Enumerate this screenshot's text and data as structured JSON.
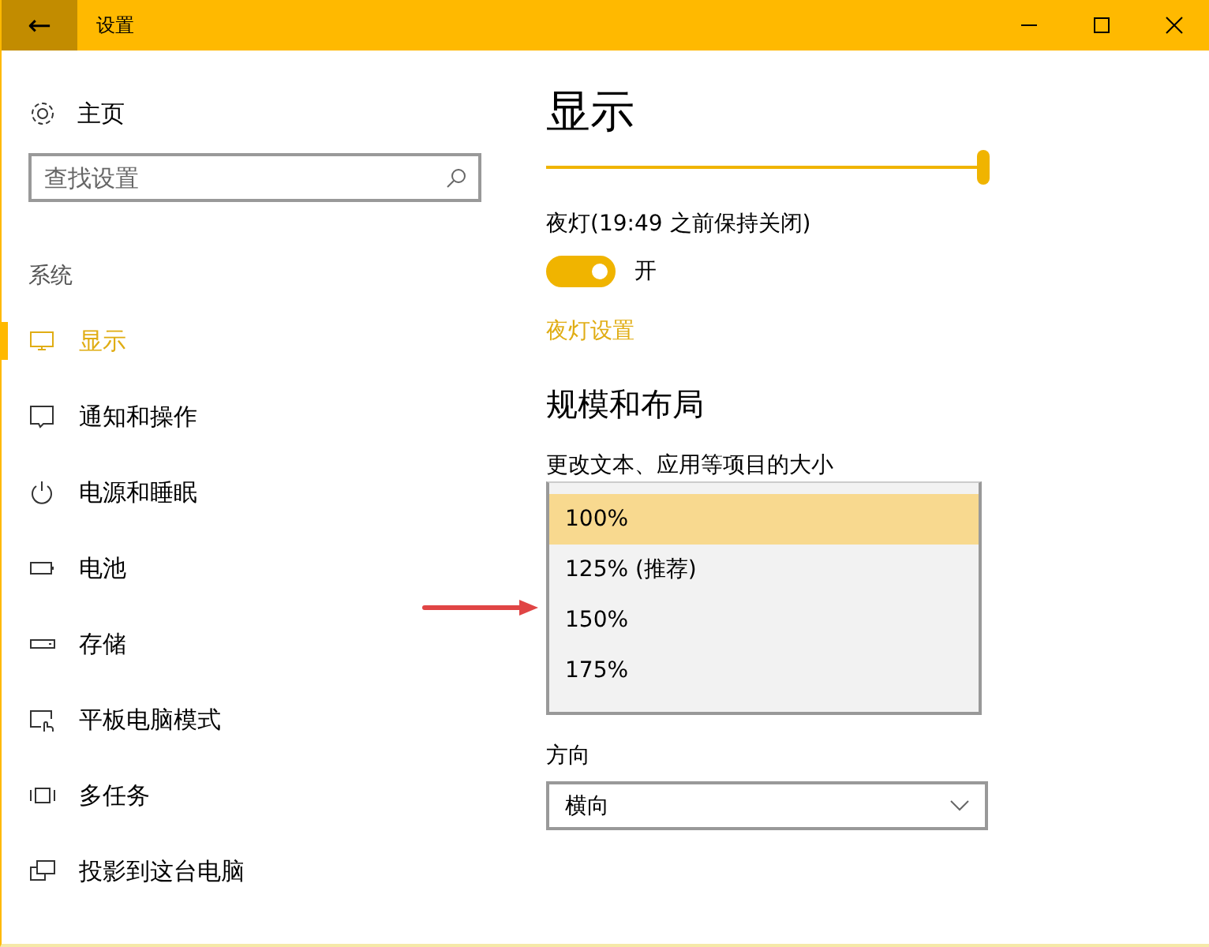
{
  "window": {
    "title": "设置",
    "back": "←"
  },
  "sidebar": {
    "home": "主页",
    "search": {
      "placeholder": "查找设置"
    },
    "section": "系统",
    "items": [
      {
        "label": "显示",
        "selected": true
      },
      {
        "label": "通知和操作",
        "selected": false
      },
      {
        "label": "电源和睡眠",
        "selected": false
      },
      {
        "label": "电池",
        "selected": false
      },
      {
        "label": "存储",
        "selected": false
      },
      {
        "label": "平板电脑模式",
        "selected": false
      },
      {
        "label": "多任务",
        "selected": false
      },
      {
        "label": "投影到这台电脑",
        "selected": false
      }
    ]
  },
  "content": {
    "title": "显示",
    "brightness": {
      "level": 1
    },
    "night_light": {
      "label": "夜灯(19:49 之前保持关闭)",
      "on": true,
      "state": "开",
      "link": "夜灯设置"
    },
    "scale_heading": "规模和布局",
    "scale_label": "更改文本、应用等项目的大小",
    "scale_options": [
      {
        "label": "100%",
        "selected": true
      },
      {
        "label": "125% (推荐)",
        "selected": false
      },
      {
        "label": "150%",
        "selected": false
      },
      {
        "label": "175%",
        "selected": false
      }
    ],
    "orientation": {
      "label": "方向",
      "value": "横向"
    }
  }
}
